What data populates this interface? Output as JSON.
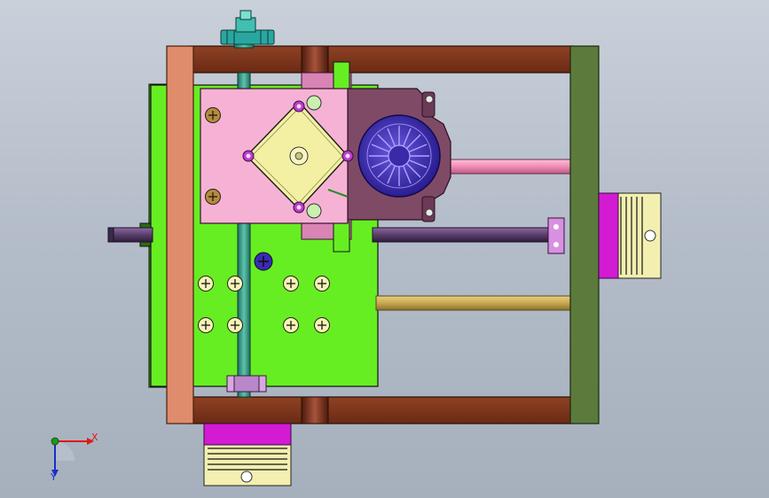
{
  "viewport": {
    "background_top": "#c9d0da",
    "background_bottom": "#a6b0bd"
  },
  "colors": {
    "frame_brown": "#7a3218",
    "frame_salmon": "#de8c6c",
    "frame_olive": "#5c7a3c",
    "base_plate_green": "#66ee22",
    "motor_plate_pink": "#f6b2d4",
    "motor_face_yellow": "#f3f0a4",
    "fan_blue": "#3a2aa8",
    "bracket_mauve": "#7e4a66",
    "rod_pink": "#f08cb4",
    "rod_purple": "#5a3e6a",
    "rod_gold": "#c8a850",
    "lead_screw_teal": "#3aa08a",
    "connector_magenta": "#d21bd2",
    "connector_cream": "#f2efb0",
    "gear_teal": "#2aa6a0"
  },
  "triad": {
    "x_label": "X",
    "y_label": "Y",
    "x_color": "#e01818",
    "y_color": "#1a30c8",
    "z_color": "#1a9a1a"
  },
  "icons": {
    "screw": "phillips-screw-icon",
    "fan": "fan-icon",
    "gear": "gear-icon"
  }
}
